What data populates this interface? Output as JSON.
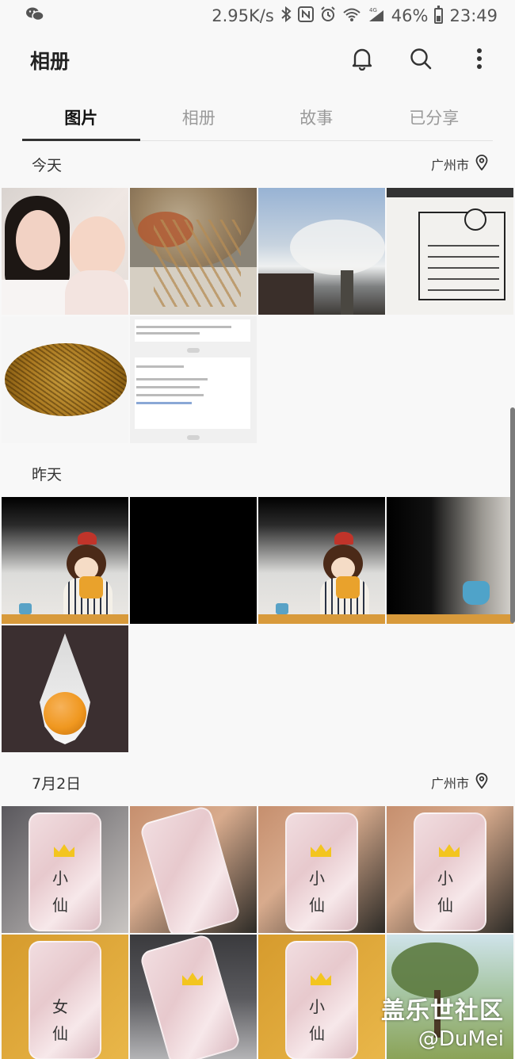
{
  "status_bar": {
    "network_speed": "2.95K/s",
    "network_type": "4G",
    "battery": "46%",
    "battery_level": 0.46,
    "time": "23:49",
    "icons": [
      "wechat-icon",
      "bluetooth-icon",
      "nfc-icon",
      "alarm-icon",
      "wifi-icon",
      "signal-icon",
      "battery-icon"
    ]
  },
  "header": {
    "title": "相册",
    "icons": [
      "bell-icon",
      "search-icon",
      "more-vert-icon"
    ]
  },
  "tabs": [
    {
      "label": "图片",
      "active": true
    },
    {
      "label": "相册",
      "active": false
    },
    {
      "label": "故事",
      "active": false
    },
    {
      "label": "已分享",
      "active": false
    }
  ],
  "sections": [
    {
      "date": "今天",
      "location": "广州市",
      "items": [
        {
          "thumbnail": "selfie"
        },
        {
          "thumbnail": "hotpot"
        },
        {
          "thumbnail": "sky"
        },
        {
          "thumbnail": "handwritten-note"
        },
        {
          "thumbnail": "noodles"
        },
        {
          "thumbnail": "message-screenshot"
        }
      ]
    },
    {
      "date": "昨天",
      "location": "",
      "items": [
        {
          "thumbnail": "illustration-girl"
        },
        {
          "thumbnail": "black"
        },
        {
          "thumbnail": "illustration-girl"
        },
        {
          "thumbnail": "illustration-teapot"
        },
        {
          "thumbnail": "egg-drop-logo"
        }
      ]
    },
    {
      "date": "7月2日",
      "location": "广州市",
      "items": [
        {
          "thumbnail": "phone-case"
        },
        {
          "thumbnail": "phone-case-in-hand"
        },
        {
          "thumbnail": "phone-case"
        },
        {
          "thumbnail": "phone-case-in-hand"
        },
        {
          "thumbnail": "phone-case"
        },
        {
          "thumbnail": "phone-case"
        },
        {
          "thumbnail": "phone-case"
        },
        {
          "thumbnail": "tree-landscape"
        }
      ]
    }
  ],
  "phone_case_text": [
    "小",
    "仙",
    "女"
  ],
  "watermark": {
    "line1": "盖乐世社区",
    "line2": "@DuMei"
  },
  "colors": {
    "accent": "#333333",
    "inactive_tab": "#9a9a9a",
    "background": "#f8f8f8"
  }
}
